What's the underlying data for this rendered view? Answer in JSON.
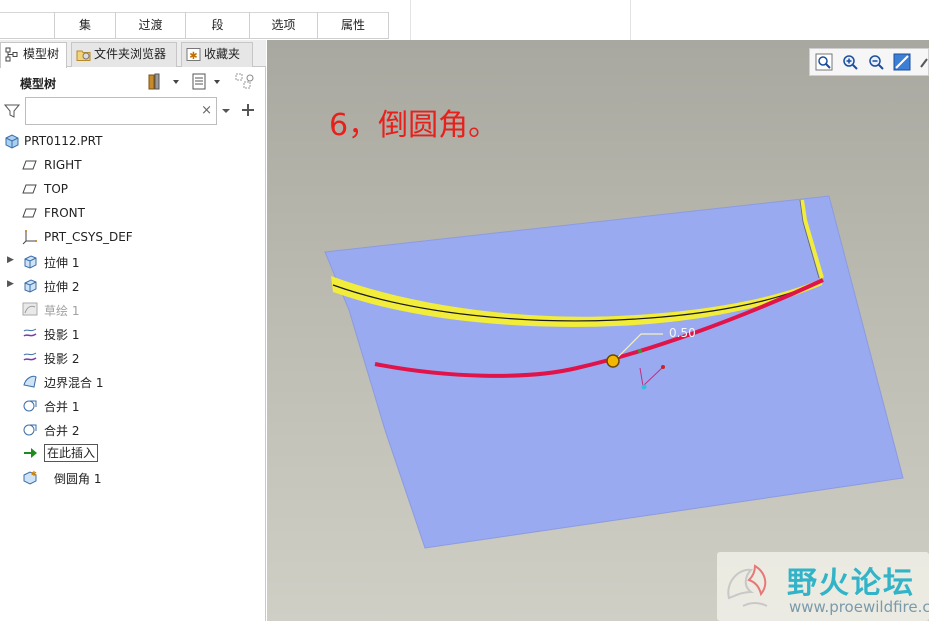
{
  "ribbon": {
    "groups": [
      "集",
      "过渡",
      "段",
      "选项",
      "属性"
    ]
  },
  "panel": {
    "tabs": [
      {
        "label": "模型树",
        "icon": "model-tree-icon"
      },
      {
        "label": "文件夹浏览器",
        "icon": "folder-browser-icon"
      },
      {
        "label": "收藏夹",
        "icon": "favorites-icon"
      }
    ],
    "title": "模型树",
    "search": {
      "value": "",
      "placeholder": "",
      "clear": "×"
    }
  },
  "tree": {
    "items": [
      {
        "label": "PRT0112.PRT",
        "icon": "part-icon",
        "expandable": false
      },
      {
        "label": "RIGHT",
        "icon": "datum-plane-icon",
        "expandable": false
      },
      {
        "label": "TOP",
        "icon": "datum-plane-icon",
        "expandable": false
      },
      {
        "label": "FRONT",
        "icon": "datum-plane-icon",
        "expandable": false
      },
      {
        "label": "PRT_CSYS_DEF",
        "icon": "csys-icon",
        "expandable": false
      },
      {
        "label": "拉伸 1",
        "icon": "extrude-icon",
        "expandable": true
      },
      {
        "label": "拉伸 2",
        "icon": "extrude-icon",
        "expandable": true
      },
      {
        "label": "草绘 1",
        "icon": "sketch-icon",
        "expandable": false,
        "dim": true
      },
      {
        "label": "投影 1",
        "icon": "project-icon",
        "expandable": false
      },
      {
        "label": "投影 2",
        "icon": "project-icon",
        "expandable": false
      },
      {
        "label": "边界混合 1",
        "icon": "boundary-blend-icon",
        "expandable": false
      },
      {
        "label": "合并 1",
        "icon": "merge-icon",
        "expandable": false
      },
      {
        "label": "合并 2",
        "icon": "merge-icon",
        "expandable": false
      },
      {
        "label": "在此插入",
        "icon": "insert-here-arrow-icon",
        "expandable": false,
        "boxed": true
      },
      {
        "label": "倒圆角 1",
        "icon": "round-icon",
        "expandable": false
      }
    ]
  },
  "graphics": {
    "step_title": "6，倒圆角。",
    "dimension_value": "0.50",
    "tools": [
      "refit-icon",
      "zoom-in-icon",
      "zoom-out-icon",
      "repaint-icon"
    ]
  },
  "watermark": {
    "cn": "野火论坛",
    "en": "www.proewildfire.cn"
  },
  "colors": {
    "surface": "#9aaaf0",
    "yellow_edge": "#f2ec3a",
    "red_edge": "#e0144a",
    "title_red": "#e8201c",
    "watermark_cyan": "#32b3c8"
  }
}
